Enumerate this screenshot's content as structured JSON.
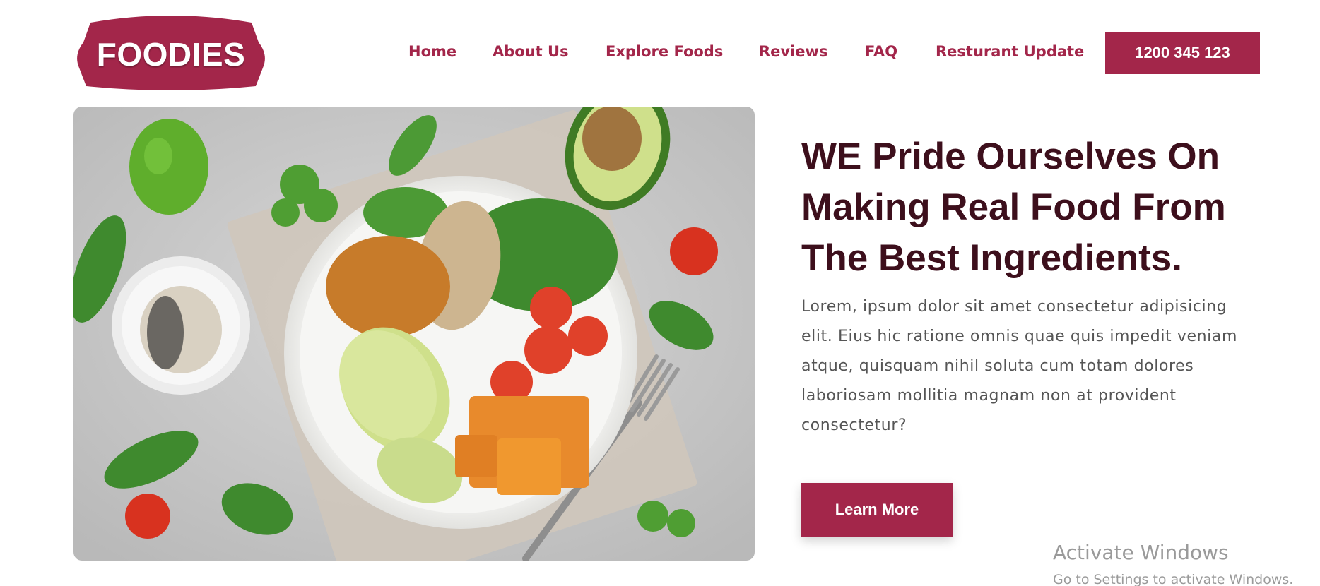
{
  "brand": {
    "logo_text": "FOODIES",
    "color": "#a3264a"
  },
  "nav": {
    "items": [
      {
        "label": "Home"
      },
      {
        "label": "About Us"
      },
      {
        "label": "Explore Foods"
      },
      {
        "label": "Reviews"
      },
      {
        "label": "FAQ"
      },
      {
        "label": "Resturant Update"
      }
    ],
    "phone": "1200 345 123"
  },
  "hero": {
    "image_subject": "salad-bowl-photo",
    "headline_lines": [
      "WE Pride Ourselves On",
      "Making Real Food From",
      "The Best Ingredients."
    ],
    "body_lines": [
      "Lorem, ipsum dolor sit amet consectetur adipisicing",
      "elit. Eius hic ratione omnis quae quis impedit veniam",
      "atque, quisquam nihil soluta cum totam dolores",
      "laboriosam mollitia magnam non at provident",
      "consectetur?"
    ],
    "cta_label": "Learn More"
  },
  "watermark": {
    "title": "Activate Windows",
    "subtitle": "Go to Settings to activate Windows."
  },
  "colors": {
    "accent": "#a3264a",
    "headline": "#3d0f1c",
    "body": "#555555"
  }
}
